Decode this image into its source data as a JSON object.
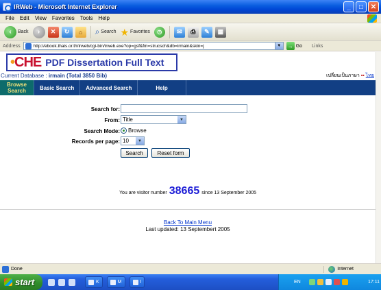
{
  "window": {
    "title": "IRWeb - Microsoft Internet Explorer"
  },
  "menubar": {
    "items": [
      "File",
      "Edit",
      "View",
      "Favorites",
      "Tools",
      "Help"
    ]
  },
  "toolbar": {
    "back_label": "Back",
    "search_label": "Search",
    "favorites_label": "Favorites"
  },
  "addressbar": {
    "label": "Address",
    "url": "http://ebook.thais.or.th/irweb/cgi-bin/irweb.exe?op=gsf&fm=strucsch&db=irmain&skin=j",
    "go_label": "Go",
    "links_label": "Links"
  },
  "banner": {
    "logo_text": "CHE",
    "title": "PDF Dissertation Full Text"
  },
  "database": {
    "label": "Current Database : ",
    "name": "irmain (Total 3850 Bib)",
    "lang_text": "เปลี่ยนเป็นภาษา",
    "lang_flag": "▪▪",
    "lang_link": "ไทย"
  },
  "nav": {
    "tabs": [
      {
        "label": "Browse Search",
        "active": true
      },
      {
        "label": "Basic Search",
        "active": false
      },
      {
        "label": "Advanced Search",
        "active": false
      },
      {
        "label": "Help",
        "active": false
      }
    ]
  },
  "form": {
    "search_for_label": "Search for:",
    "search_for_value": "",
    "from_label": "From:",
    "from_value": "Title",
    "mode_label": "Search Mode:",
    "mode_value": "Browse",
    "records_label": "Records per page:",
    "records_value": "10",
    "search_button": "Search",
    "reset_button": "Reset form"
  },
  "visitor": {
    "prefix": "You are visitor number",
    "count": "38665",
    "suffix": "since 13 September 2005"
  },
  "footer": {
    "back_link": "Back To Main Menu",
    "updated": "Last updated: 13 Septembert 2005"
  },
  "statusbar": {
    "status": "Done",
    "zone": "Internet"
  },
  "taskbar": {
    "start_label": "start",
    "tasks": [
      "K",
      "M",
      "I"
    ],
    "lang": "EN",
    "clock": "17:11"
  }
}
